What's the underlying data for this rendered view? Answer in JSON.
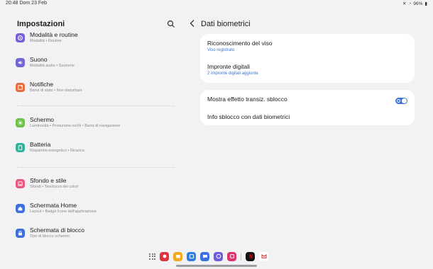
{
  "status": {
    "time_date": "20:48  Dom 23 Feb",
    "battery": "96%"
  },
  "left": {
    "title": "Impostazioni",
    "groups": [
      [
        {
          "label": "Modalità e routine",
          "sub": "Modalità  •  Routine",
          "icon": "routine-icon",
          "color": "#7b5fd9"
        },
        {
          "label": "Suono",
          "sub": "Modalità audio  •  Suonerie",
          "icon": "sound-icon",
          "color": "#7267d6"
        },
        {
          "label": "Notifiche",
          "sub": "Barra di stato  •  Non disturbare",
          "icon": "notifications-icon",
          "color": "#e96b3c"
        }
      ],
      [
        {
          "label": "Schermo",
          "sub": "Luminosità  •  Protezione occhi  •  Barra di navigazione",
          "icon": "display-icon",
          "color": "#6cc24a"
        },
        {
          "label": "Batteria",
          "sub": "Risparmio energetico  •  Ricarica",
          "icon": "battery-icon",
          "color": "#2fb39c"
        }
      ],
      [
        {
          "label": "Sfondo e stile",
          "sub": "Sfondi  •  Tavolozza dei colori",
          "icon": "wallpaper-icon",
          "color": "#e8577c"
        },
        {
          "label": "Schermata Home",
          "sub": "Layout  •  Badge icone dell'applicazione",
          "icon": "home-icon",
          "color": "#3f6fd8"
        },
        {
          "label": "Schermata di blocco",
          "sub": "Tipo di blocco schermo",
          "icon": "lock-icon",
          "color": "#3f6fd8"
        }
      ]
    ]
  },
  "right": {
    "title": "Dati biometrici",
    "card1": [
      {
        "label": "Riconoscimento del viso",
        "sub": "Viso registrato"
      },
      {
        "label": "Impronte digitali",
        "sub": "2 impronte digitali aggiunte"
      }
    ],
    "card2": {
      "toggle_label": "Mostra effetto transiz. sblocco",
      "toggle_on": true,
      "info_label": "Info sblocco con dati biometrici"
    }
  },
  "dock": {
    "apps": [
      {
        "name": "galleria",
        "color": "#e0333d"
      },
      {
        "name": "file",
        "color": "#f2a91c"
      },
      {
        "name": "calendario",
        "color": "#2e7fe0"
      },
      {
        "name": "messaggi",
        "color": "#3a6fe0"
      },
      {
        "name": "internet",
        "color": "#6b5ce0"
      },
      {
        "name": "galleria-2",
        "color": "#e0336e"
      }
    ],
    "recent": [
      {
        "name": "netflix",
        "color": "#111111"
      },
      {
        "name": "gmail",
        "color": "#ffffff"
      }
    ]
  }
}
